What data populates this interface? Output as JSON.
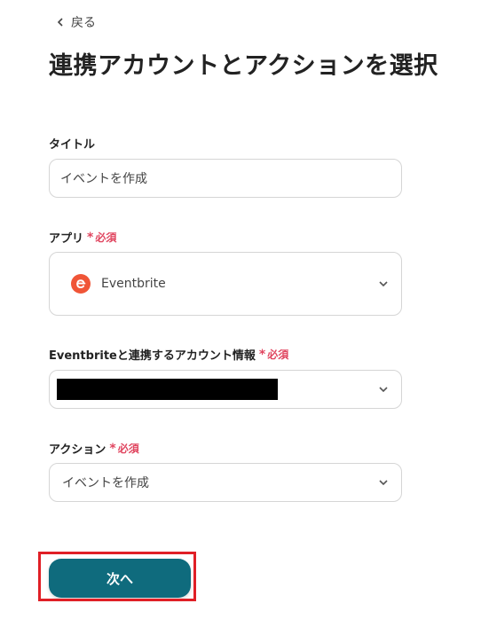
{
  "header": {
    "back_label": "戻る",
    "title": "連携アカウントとアクションを選択"
  },
  "form": {
    "title_label": "タイトル",
    "title_value": "イベントを作成",
    "app_label": "アプリ",
    "app_value": "Eventbrite",
    "account_label": "Eventbriteと連携するアカウント情報",
    "action_label": "アクション",
    "action_value": "イベントを作成",
    "required_text": "必須",
    "required_mark": "*"
  },
  "next_label": "次へ",
  "colors": {
    "brand": "#0f6b7d",
    "required": "#e0455f",
    "eventbrite": "#f05537",
    "highlight": "#e01f26"
  }
}
